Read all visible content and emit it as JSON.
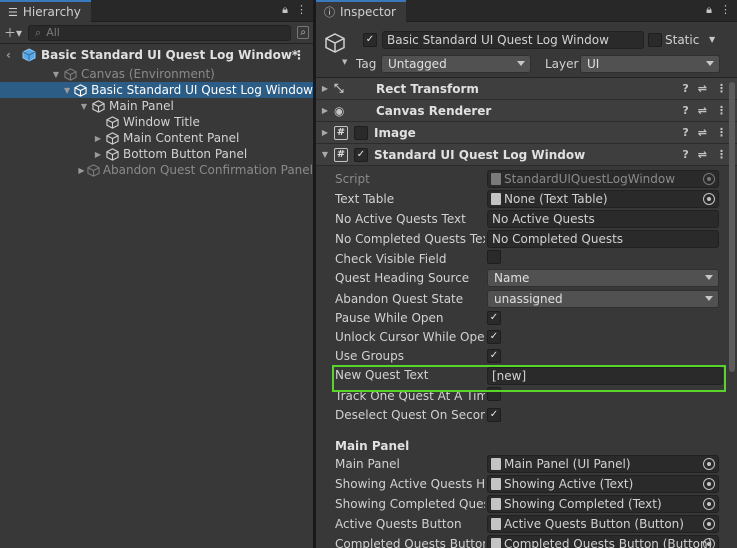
{
  "hierarchy": {
    "tab_label": "Hierarchy",
    "search_placeholder": "All",
    "scene_name": "Basic Standard UI Quest Log Window*",
    "items": [
      {
        "label": "Canvas (Environment)",
        "indent": 1,
        "arrow": "down",
        "state": "dim"
      },
      {
        "label": "Basic Standard UI Quest Log Window",
        "indent": 2,
        "arrow": "down",
        "state": "selected"
      },
      {
        "label": "Main Panel",
        "indent": 3,
        "arrow": "down",
        "state": "normal"
      },
      {
        "label": "Window Title",
        "indent": 4,
        "arrow": "none",
        "state": "normal"
      },
      {
        "label": "Main Content Panel",
        "indent": 4,
        "arrow": "right",
        "state": "normal"
      },
      {
        "label": "Bottom Button Panel",
        "indent": 4,
        "arrow": "right",
        "state": "normal"
      },
      {
        "label": "Abandon Quest Confirmation Panel",
        "indent": 4,
        "arrow": "right",
        "state": "dim"
      }
    ]
  },
  "inspector": {
    "tab_label": "Inspector",
    "object_name": "Basic Standard UI Quest Log Window",
    "static_label": "Static",
    "tag_label": "Tag",
    "tag_value": "Untagged",
    "layer_label": "Layer",
    "layer_value": "UI",
    "components": [
      {
        "name": "Rect Transform",
        "icon": "rect-transform-icon",
        "expanded": false,
        "has_checkbox": false
      },
      {
        "name": "Canvas Renderer",
        "icon": "eye-icon",
        "expanded": false,
        "has_checkbox": false
      },
      {
        "name": "Image",
        "icon": "script-hash-icon",
        "expanded": false,
        "has_checkbox": true,
        "checked": false
      },
      {
        "name": "Standard UI Quest Log Window",
        "icon": "script-hash-icon",
        "expanded": true,
        "has_checkbox": true,
        "checked": true
      }
    ],
    "properties": {
      "script": {
        "label": "Script",
        "value": "StandardUIQuestLogWindow"
      },
      "text_table": {
        "label": "Text Table",
        "value": "None (Text Table)"
      },
      "no_active": {
        "label": "No Active Quests Text",
        "value": "No Active Quests"
      },
      "no_completed": {
        "label": "No Completed Quests Text",
        "value": "No Completed Quests"
      },
      "check_visible": {
        "label": "Check Visible Field",
        "checked": false
      },
      "heading_source": {
        "label": "Quest Heading Source",
        "value": "Name"
      },
      "abandon_state": {
        "label": "Abandon Quest State",
        "value": "unassigned"
      },
      "pause_open": {
        "label": "Pause While Open",
        "checked": true
      },
      "unlock_cursor": {
        "label": "Unlock Cursor While Open",
        "checked": true
      },
      "use_groups": {
        "label": "Use Groups",
        "checked": true
      },
      "new_quest_text": {
        "label": "New Quest Text",
        "value": "[new]"
      },
      "track_one": {
        "label": "Track One Quest At A Time",
        "checked": false
      },
      "deselect": {
        "label": "Deselect Quest On Second Click",
        "checked": true
      }
    },
    "main_panel_section": "Main Panel",
    "main_panel_props": {
      "main_panel": {
        "label": "Main Panel",
        "value": "Main Panel (UI Panel)"
      },
      "showing_active": {
        "label": "Showing Active Quests Heading",
        "value": "Showing Active (Text)"
      },
      "showing_completed": {
        "label": "Showing Completed Quests Heading",
        "value": "Showing Completed (Text)"
      },
      "active_btn": {
        "label": "Active Quests Button",
        "value": "Active Quests Button (Button)"
      },
      "completed_btn": {
        "label": "Completed Quests Button",
        "value": "Completed Quests Button (Button)"
      }
    },
    "highlight_color": "#5ad42a"
  },
  "colors": {
    "panel_bg": "#383838",
    "selected_row": "#2c5d87",
    "tab_bar": "#282828"
  }
}
